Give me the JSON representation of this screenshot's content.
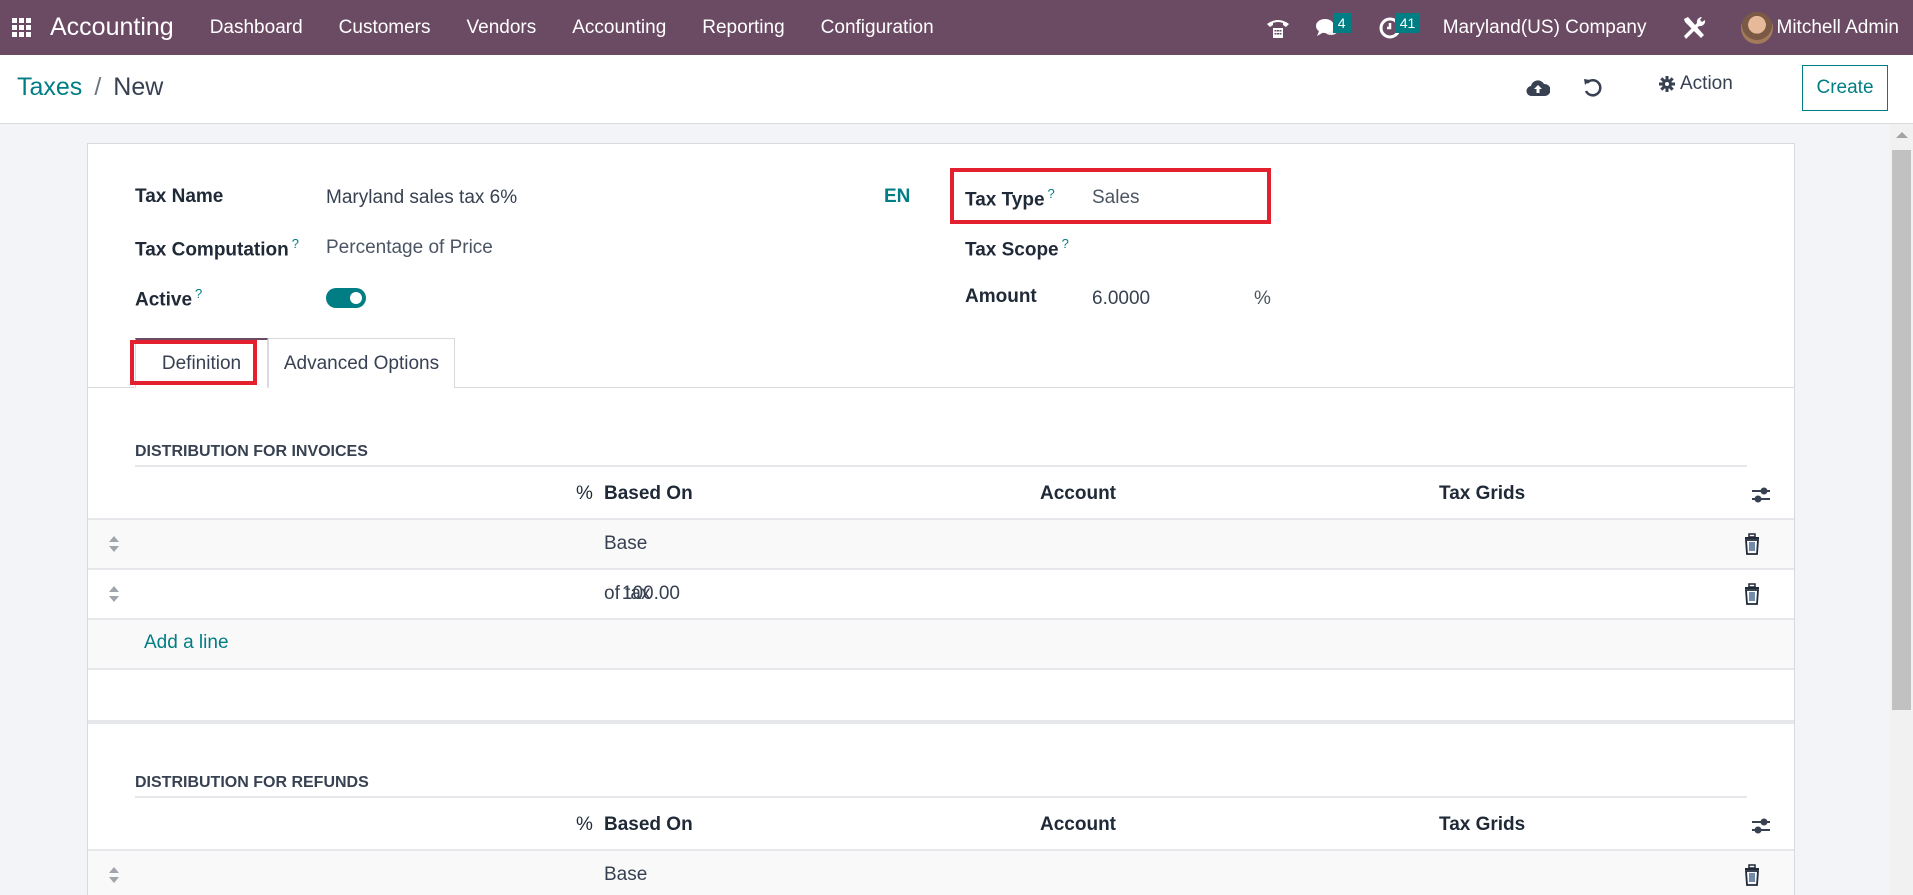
{
  "navbar": {
    "app_name": "Accounting",
    "menu": [
      "Dashboard",
      "Customers",
      "Vendors",
      "Accounting",
      "Reporting",
      "Configuration"
    ],
    "messages_badge": "4",
    "activities_badge": "41",
    "company": "Maryland(US) Company",
    "user": "Mitchell Admin",
    "brand_color": "#6b4a64",
    "accent_color": "#017e84"
  },
  "breadcrumb": {
    "parent": "Taxes",
    "separator": "/",
    "current": "New"
  },
  "control_panel": {
    "action_label": "Action",
    "create_label": "Create"
  },
  "form": {
    "tax_name_label": "Tax Name",
    "tax_name_value": "Maryland sales tax 6%",
    "lang_label": "EN",
    "tax_computation_label": "Tax Computation",
    "tax_computation_value": "Percentage of Price",
    "active_label": "Active",
    "active_value": true,
    "tax_type_label": "Tax Type",
    "tax_type_value": "Sales",
    "tax_scope_label": "Tax Scope",
    "tax_scope_value": "",
    "amount_label": "Amount",
    "amount_value": "6.0000",
    "amount_unit": "%",
    "help_mark": "?"
  },
  "tabs": [
    {
      "label": "Definition",
      "active": true
    },
    {
      "label": "Advanced Options",
      "active": false
    }
  ],
  "invoices": {
    "title": "DISTRIBUTION FOR INVOICES",
    "columns": {
      "pct": "%",
      "based_on": "Based On",
      "account": "Account",
      "tax_grids": "Tax Grids"
    },
    "rows": [
      {
        "pct": "",
        "based_on": "Base",
        "account": "",
        "tax_grids": ""
      },
      {
        "pct": "100.00",
        "based_on": "of tax",
        "account": "",
        "tax_grids": ""
      }
    ],
    "add_line": "Add a line"
  },
  "refunds": {
    "title": "DISTRIBUTION FOR REFUNDS",
    "columns": {
      "pct": "%",
      "based_on": "Based On",
      "account": "Account",
      "tax_grids": "Tax Grids"
    },
    "rows": [
      {
        "pct": "",
        "based_on": "Base",
        "account": "",
        "tax_grids": ""
      }
    ]
  }
}
